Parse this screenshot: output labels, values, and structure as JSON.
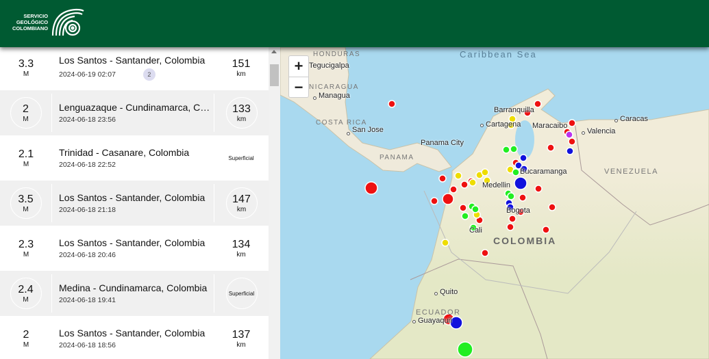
{
  "header": {
    "logo_text": [
      "SERVICIO",
      "GEOLÓGICO",
      "COLOMBIANO"
    ],
    "bg_color": "#005a32"
  },
  "events": [
    {
      "magnitude": "3.3",
      "mag_unit": "M",
      "place": "Los Santos - Santander, Colombia",
      "datetime": "2024-06-19 02:07",
      "badge": "2",
      "depth": "151",
      "depth_unit": "km"
    },
    {
      "magnitude": "2",
      "mag_unit": "M",
      "place": "Lenguazaque - Cundinamarca, Colombia",
      "datetime": "2024-06-18 23:56",
      "depth": "133",
      "depth_unit": "km"
    },
    {
      "magnitude": "2.1",
      "mag_unit": "M",
      "place": "Trinidad - Casanare, Colombia",
      "datetime": "2024-06-18 22:52",
      "depth_label": "Superficial"
    },
    {
      "magnitude": "3.5",
      "mag_unit": "M",
      "place": "Los Santos - Santander, Colombia",
      "datetime": "2024-06-18 21:18",
      "depth": "147",
      "depth_unit": "km"
    },
    {
      "magnitude": "2.3",
      "mag_unit": "M",
      "place": "Los Santos - Santander, Colombia",
      "datetime": "2024-06-18 20:46",
      "depth": "134",
      "depth_unit": "km"
    },
    {
      "magnitude": "2.4",
      "mag_unit": "M",
      "place": "Medina - Cundinamarca, Colombia",
      "datetime": "2024-06-18 19:41",
      "depth_label": "Superficial"
    },
    {
      "magnitude": "2",
      "mag_unit": "M",
      "place": "Los Santos - Santander, Colombia",
      "datetime": "2024-06-18 18:56",
      "depth": "137",
      "depth_unit": "km"
    }
  ],
  "map": {
    "zoom_in": "+",
    "zoom_out": "−",
    "sea_label": "Caribbean Sea",
    "countries": {
      "honduras": "HONDURAS",
      "nicaragua": "NICARAGUA",
      "costa_rica": "COSTA RICA",
      "panama": "PANAMA",
      "venezuela": "VENEZUELA",
      "colombia": "COLOMBIA",
      "ecuador": "ECUADOR"
    },
    "cities": {
      "tegucigalpa": "Tegucigalpa",
      "managua": "Managua",
      "san_jose": "San Jose",
      "panama_city": "Panama City",
      "barranquilla": "Barranquilla",
      "cartagena": "Cartagena",
      "maracaibo": "Maracaibo",
      "caracas": "Caracas",
      "valencia": "Valencia",
      "bucaramanga": "Bucaramanga",
      "medellin": "Medellin",
      "bogota": "Bogota",
      "cali": "Cali",
      "quito": "Quito",
      "guayaquil": "Guayaquil"
    },
    "marker_colors": {
      "red": "#ee1111",
      "yellow": "#eedd00",
      "green": "#22ee22",
      "blue": "#1111dd",
      "purple": "#bb33ee"
    }
  }
}
